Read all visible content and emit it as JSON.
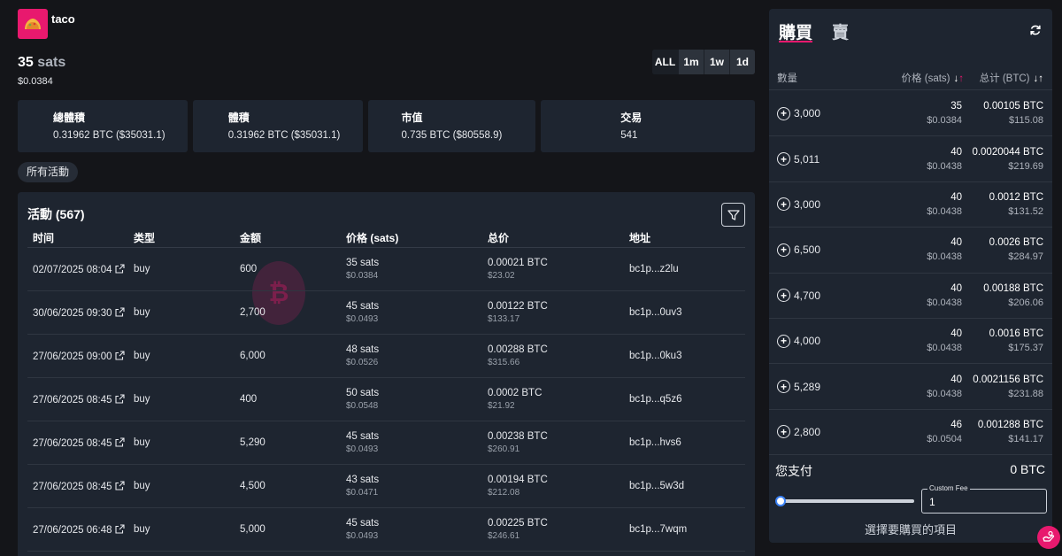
{
  "token": {
    "name": "taco",
    "price_value": "35",
    "price_unit": "sats",
    "price_usd": "$0.0384"
  },
  "timeframes": [
    "ALL",
    "1m",
    "1w",
    "1d"
  ],
  "stats": [
    {
      "title": "總體積",
      "value": "0.31962 BTC ($35031.1)"
    },
    {
      "title": "體積",
      "value": "0.31962 BTC ($35031.1)"
    },
    {
      "title": "市值",
      "value": "0.735 BTC ($80558.9)"
    },
    {
      "title": "交易",
      "value": "541"
    }
  ],
  "filter_chip": "所有活動",
  "activity": {
    "title": "活動 (567)",
    "columns": [
      "时间",
      "类型",
      "金额",
      "价格 (sats)",
      "总价",
      "地址"
    ],
    "rows": [
      {
        "time": "02/07/2025 08:04",
        "type": "buy",
        "amount": "600",
        "price": "35 sats",
        "price_usd": "$0.0384",
        "total": "0.00021 BTC",
        "total_usd": "$23.02",
        "address": "bc1p...z2lu"
      },
      {
        "time": "30/06/2025 09:30",
        "type": "buy",
        "amount": "2,700",
        "price": "45 sats",
        "price_usd": "$0.0493",
        "total": "0.00122 BTC",
        "total_usd": "$133.17",
        "address": "bc1p...0uv3"
      },
      {
        "time": "27/06/2025 09:00",
        "type": "buy",
        "amount": "6,000",
        "price": "48 sats",
        "price_usd": "$0.0526",
        "total": "0.00288 BTC",
        "total_usd": "$315.66",
        "address": "bc1p...0ku3"
      },
      {
        "time": "27/06/2025 08:45",
        "type": "buy",
        "amount": "400",
        "price": "50 sats",
        "price_usd": "$0.0548",
        "total": "0.0002 BTC",
        "total_usd": "$21.92",
        "address": "bc1p...q5z6"
      },
      {
        "time": "27/06/2025 08:45",
        "type": "buy",
        "amount": "5,290",
        "price": "45 sats",
        "price_usd": "$0.0493",
        "total": "0.00238 BTC",
        "total_usd": "$260.91",
        "address": "bc1p...hvs6"
      },
      {
        "time": "27/06/2025 08:45",
        "type": "buy",
        "amount": "4,500",
        "price": "43 sats",
        "price_usd": "$0.0471",
        "total": "0.00194 BTC",
        "total_usd": "$212.08",
        "address": "bc1p...5w3d"
      },
      {
        "time": "27/06/2025 06:48",
        "type": "buy",
        "amount": "5,000",
        "price": "45 sats",
        "price_usd": "$0.0493",
        "total": "0.00225 BTC",
        "total_usd": "$246.61",
        "address": "bc1p...7wqm"
      }
    ]
  },
  "panel": {
    "tab_buy": "購買",
    "tab_sell": "賣",
    "col_qty": "數量",
    "col_price": "价格 (sats)",
    "col_total": "总计 (BTC)",
    "orders": [
      {
        "qty": "3,000",
        "price": "35",
        "price_usd": "$0.0384",
        "total": "0.00105 BTC",
        "total_usd": "$115.08"
      },
      {
        "qty": "5,011",
        "price": "40",
        "price_usd": "$0.0438",
        "total": "0.0020044 BTC",
        "total_usd": "$219.69"
      },
      {
        "qty": "3,000",
        "price": "40",
        "price_usd": "$0.0438",
        "total": "0.0012 BTC",
        "total_usd": "$131.52"
      },
      {
        "qty": "6,500",
        "price": "40",
        "price_usd": "$0.0438",
        "total": "0.0026 BTC",
        "total_usd": "$284.97"
      },
      {
        "qty": "4,700",
        "price": "40",
        "price_usd": "$0.0438",
        "total": "0.00188 BTC",
        "total_usd": "$206.06"
      },
      {
        "qty": "4,000",
        "price": "40",
        "price_usd": "$0.0438",
        "total": "0.0016 BTC",
        "total_usd": "$175.37"
      },
      {
        "qty": "5,289",
        "price": "40",
        "price_usd": "$0.0438",
        "total": "0.0021156 BTC",
        "total_usd": "$231.88"
      },
      {
        "qty": "2,800",
        "price": "46",
        "price_usd": "$0.0504",
        "total": "0.001288 BTC",
        "total_usd": "$141.17"
      }
    ],
    "pay_label": "您支付",
    "pay_value": "0 BTC",
    "fee_label": "Custom Fee",
    "fee_value": "1",
    "select_hint": "選擇要購買的項目"
  },
  "colors": {
    "accent": "#e8196e",
    "background": "#141519",
    "card": "#1e2530"
  },
  "icons": [
    "taco-logo-icon",
    "external-link-icon",
    "filter-icon",
    "refresh-icon",
    "plus-circle-icon",
    "sort-icon",
    "bitcoin-icon",
    "chat-icon"
  ]
}
